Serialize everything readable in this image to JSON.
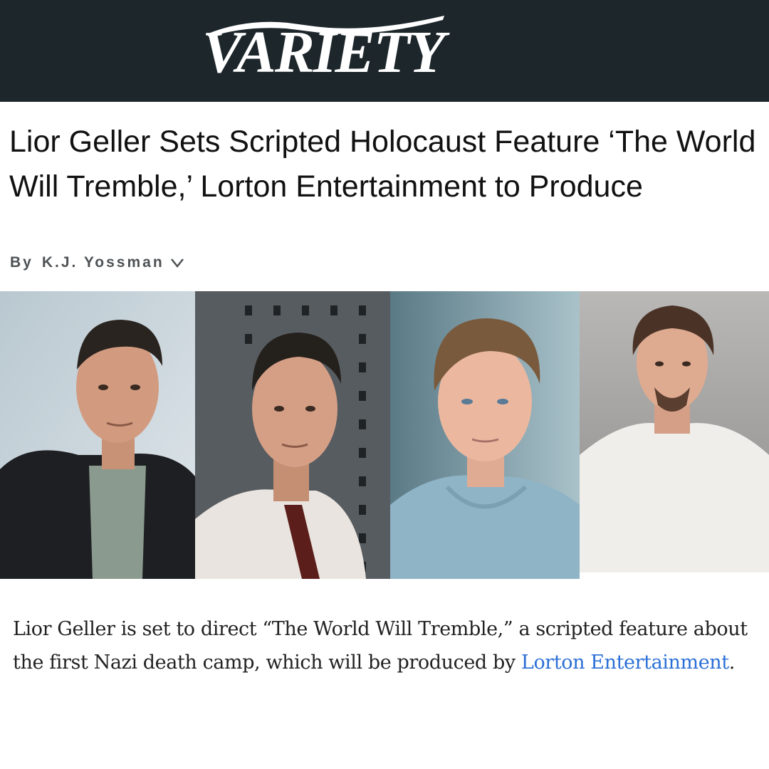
{
  "masthead": {
    "logo_text": "VARIETY",
    "logo_icon": "variety-logo"
  },
  "article": {
    "headline": "Lior Geller Sets Scripted Holocaust Feature ‘The World Will Tremble,’ Lorton Entertainment to Produce",
    "byline_prefix": "By",
    "byline_author": "K.J. Yossman",
    "byline_icon": "chevron-down-icon",
    "photos": [
      {
        "subject": "actor-photo-1-dark-jacket"
      },
      {
        "subject": "actor-photo-2-white-shirt-tie"
      },
      {
        "subject": "actor-photo-3-blue-sweater"
      },
      {
        "subject": "actor-photo-4-white-tshirt"
      }
    ],
    "body_before_link": "Lior Geller is set to direct “The World Will Tremble,” a scripted feature about the first Nazi death camp, which will be produced by ",
    "body_link": "Lorton Entertainment",
    "body_after_link": "."
  },
  "colors": {
    "masthead_bg": "#1c262b",
    "link": "#2b6fd6",
    "byline": "#4e5255"
  }
}
